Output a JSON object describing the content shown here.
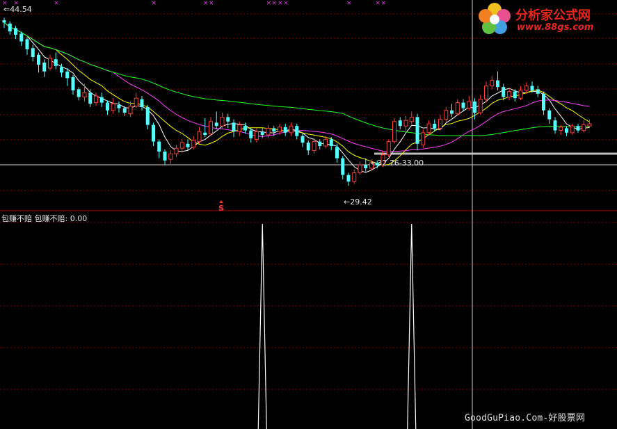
{
  "chart_data": [
    {
      "type": "candlestick",
      "labels": {
        "high_marker": "44.54",
        "low_marker": "29.42",
        "target_range": "32.76-33.00",
        "sell_signal": "S"
      },
      "candles": [
        [
          44.3,
          44.1,
          44.54,
          43.6
        ],
        [
          44.0,
          43.3,
          44.2,
          43.0
        ],
        [
          43.6,
          43.0,
          43.8,
          42.6
        ],
        [
          43.1,
          42.4,
          43.3,
          42.0
        ],
        [
          42.6,
          41.7,
          42.8,
          41.2
        ],
        [
          41.8,
          41.0,
          42.1,
          40.6
        ],
        [
          41.2,
          40.3,
          41.4,
          39.6
        ],
        [
          40.5,
          39.7,
          40.8,
          39.2
        ],
        [
          40.0,
          40.9,
          41.2,
          39.8
        ],
        [
          40.8,
          40.2,
          41.4,
          39.9
        ],
        [
          40.1,
          39.6,
          40.4,
          39.2
        ],
        [
          39.7,
          39.1,
          40.0,
          38.4
        ],
        [
          39.2,
          38.0,
          39.4,
          37.6
        ],
        [
          38.1,
          37.4,
          38.3,
          37.1
        ],
        [
          37.4,
          37.8,
          38.6,
          37.0
        ],
        [
          37.8,
          36.8,
          38.1,
          36.5
        ],
        [
          36.9,
          37.5,
          37.8,
          36.6
        ],
        [
          37.4,
          36.9,
          37.8,
          36.5
        ],
        [
          36.9,
          36.2,
          37.1,
          35.8
        ],
        [
          36.2,
          36.8,
          37.3,
          35.9
        ],
        [
          36.7,
          36.4,
          37.0,
          36.0
        ],
        [
          36.4,
          36.0,
          36.6,
          35.7
        ],
        [
          35.9,
          36.6,
          37.0,
          35.6
        ],
        [
          36.6,
          37.3,
          37.8,
          36.4
        ],
        [
          37.2,
          36.5,
          37.5,
          36.2
        ],
        [
          36.5,
          34.9,
          36.7,
          34.5
        ],
        [
          34.9,
          33.4,
          35.1,
          33.0
        ],
        [
          33.4,
          32.5,
          33.6,
          31.9
        ],
        [
          32.5,
          31.7,
          32.7,
          31.3
        ],
        [
          31.8,
          32.3,
          32.6,
          31.4
        ],
        [
          32.3,
          32.8,
          33.1,
          32.0
        ],
        [
          32.8,
          33.3,
          33.6,
          32.4
        ],
        [
          33.2,
          32.9,
          33.6,
          32.6
        ],
        [
          32.9,
          33.5,
          33.9,
          32.7
        ],
        [
          33.4,
          34.3,
          34.7,
          33.2
        ],
        [
          34.2,
          34.0,
          35.5,
          33.8
        ],
        [
          34.1,
          35.2,
          35.6,
          33.9
        ],
        [
          35.1,
          34.8,
          36.1,
          34.5
        ],
        [
          34.8,
          35.6,
          36.0,
          34.6
        ],
        [
          35.6,
          35.2,
          35.9,
          34.6
        ],
        [
          35.1,
          34.3,
          35.4,
          33.8
        ],
        [
          34.3,
          34.9,
          35.2,
          33.9
        ],
        [
          34.8,
          34.4,
          35.1,
          34.1
        ],
        [
          34.4,
          33.7,
          34.6,
          33.3
        ],
        [
          33.6,
          34.3,
          34.6,
          33.3
        ],
        [
          34.3,
          34.0,
          34.6,
          33.7
        ],
        [
          34.0,
          34.6,
          34.9,
          33.7
        ],
        [
          34.6,
          34.3,
          34.8,
          33.9
        ],
        [
          34.3,
          34.7,
          35.0,
          34.0
        ],
        [
          34.7,
          34.2,
          35.0,
          33.9
        ],
        [
          34.2,
          34.8,
          35.1,
          33.9
        ],
        [
          34.8,
          33.9,
          35.0,
          33.6
        ],
        [
          33.9,
          33.3,
          34.2,
          32.9
        ],
        [
          33.3,
          32.6,
          33.5,
          32.2
        ],
        [
          32.6,
          33.4,
          33.7,
          32.3
        ],
        [
          33.4,
          33.0,
          33.6,
          32.7
        ],
        [
          33.0,
          33.6,
          33.9,
          32.8
        ],
        [
          33.6,
          33.0,
          33.8,
          32.6
        ],
        [
          32.9,
          31.9,
          33.2,
          31.5
        ],
        [
          31.9,
          30.4,
          32.1,
          30.0
        ],
        [
          30.4,
          29.8,
          30.6,
          29.42
        ],
        [
          29.8,
          30.6,
          30.9,
          29.6
        ],
        [
          30.6,
          31.3,
          31.6,
          30.4
        ],
        [
          31.3,
          31.0,
          31.9,
          30.7
        ],
        [
          31.0,
          31.5,
          31.8,
          30.8
        ],
        [
          31.5,
          31.3,
          31.7,
          31.0
        ],
        [
          31.3,
          32.2,
          32.5,
          31.1
        ],
        [
          32.2,
          33.4,
          33.6,
          32.0
        ],
        [
          33.4,
          35.2,
          35.5,
          33.2
        ],
        [
          35.3,
          34.8,
          35.6,
          34.5
        ],
        [
          34.8,
          35.3,
          35.7,
          34.4
        ],
        [
          35.2,
          35.6,
          36.1,
          35.0
        ],
        [
          35.6,
          33.2,
          35.9,
          32.6
        ],
        [
          33.1,
          34.2,
          34.5,
          32.8
        ],
        [
          34.2,
          35.0,
          35.3,
          34.0
        ],
        [
          35.0,
          34.6,
          35.4,
          34.3
        ],
        [
          34.6,
          35.4,
          35.8,
          34.4
        ],
        [
          35.4,
          36.2,
          36.5,
          35.1
        ],
        [
          36.2,
          35.9,
          36.8,
          35.6
        ],
        [
          35.9,
          36.9,
          37.2,
          35.7
        ],
        [
          36.9,
          36.4,
          37.2,
          36.1
        ],
        [
          36.4,
          37.0,
          37.5,
          36.2
        ],
        [
          37.0,
          36.0,
          37.3,
          35.4
        ],
        [
          36.0,
          37.2,
          37.6,
          35.8
        ],
        [
          37.2,
          38.4,
          38.8,
          36.9
        ],
        [
          38.4,
          38.9,
          39.3,
          38.1
        ],
        [
          38.9,
          38.3,
          39.7,
          38.0
        ],
        [
          38.3,
          37.4,
          38.6,
          37.1
        ],
        [
          37.4,
          37.9,
          38.2,
          37.1
        ],
        [
          37.9,
          37.3,
          38.1,
          37.0
        ],
        [
          37.3,
          38.0,
          38.4,
          37.1
        ],
        [
          38.0,
          38.4,
          38.7,
          37.7
        ],
        [
          38.4,
          38.0,
          38.8,
          37.8
        ],
        [
          38.1,
          37.7,
          38.4,
          37.4
        ],
        [
          37.7,
          36.2,
          37.9,
          35.8
        ],
        [
          36.2,
          35.4,
          36.4,
          35.0
        ],
        [
          35.3,
          34.4,
          35.6,
          34.1
        ],
        [
          34.4,
          34.7,
          34.9,
          34.0
        ],
        [
          34.6,
          34.2,
          34.8,
          33.9
        ],
        [
          34.2,
          34.8,
          35.0,
          34.0
        ],
        [
          34.8,
          34.4,
          35.0,
          34.2
        ],
        [
          34.4,
          34.9,
          35.3,
          34.2
        ],
        [
          34.8,
          35.0,
          35.4,
          34.6
        ]
      ],
      "moving_averages": [
        {
          "color": "#ffffff",
          "period": 5
        },
        {
          "color": "#ffff00",
          "period": 10
        },
        {
          "color": "#ff40ff",
          "period": 20
        },
        {
          "color": "#20ff20",
          "period": 60
        }
      ],
      "ylim": [
        28.5,
        45.0
      ]
    },
    {
      "type": "line",
      "title": "包赚不赔  包赚不赔: 0.00",
      "series": [
        {
          "spikes_at_index": [
            45,
            71
          ],
          "value": 1
        }
      ],
      "ylim": [
        0,
        1
      ]
    }
  ],
  "branding": {
    "logo_title": "分析家公式网",
    "logo_url": "www.88gs.com",
    "watermark": "GoodGuPiao.Com-好股票网"
  }
}
